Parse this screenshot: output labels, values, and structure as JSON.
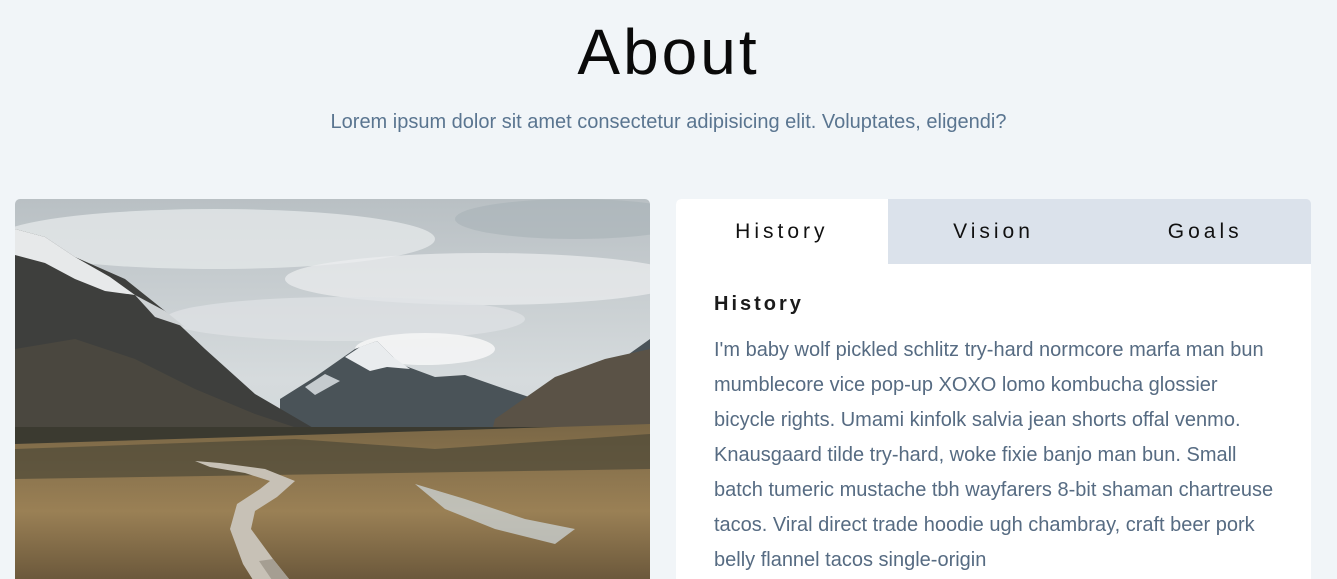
{
  "header": {
    "title": "About",
    "subtitle": "Lorem ipsum dolor sit amet consectetur adipisicing elit. Voluptates, eligendi?"
  },
  "image": {
    "description": "mountain-valley-boardwalk"
  },
  "tabs": {
    "active": "History",
    "items": [
      {
        "label": "History"
      },
      {
        "label": "Vision"
      },
      {
        "label": "Goals"
      }
    ]
  },
  "content": {
    "heading": "History",
    "body": "I'm baby wolf pickled schlitz try-hard normcore marfa man bun mumblecore vice pop-up XOXO lomo kombucha glossier bicycle rights. Umami kinfolk salvia jean shorts offal venmo. Knausgaard tilde try-hard, woke fixie banjo man bun. Small batch tumeric mustache tbh wayfarers 8-bit shaman chartreuse tacos. Viral direct trade hoodie ugh chambray, craft beer pork belly flannel tacos single-origin"
  },
  "colors": {
    "background": "#f1f5f8",
    "tab_inactive": "#dbe2eb",
    "tab_active": "#ffffff",
    "body_text": "#566b82",
    "subtitle_text": "#5a7590"
  }
}
